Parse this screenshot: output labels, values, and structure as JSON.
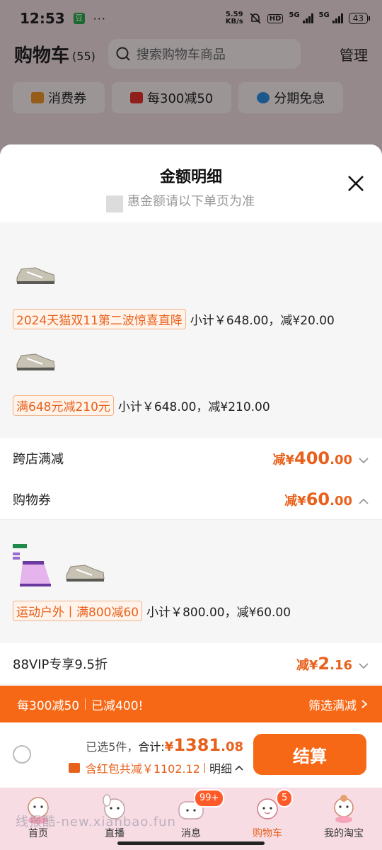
{
  "status_bar": {
    "time": "12:53",
    "app_badge": "豆",
    "more": "···",
    "speed_top": "5.59",
    "speed_bottom": "KB/s",
    "hd": "HD",
    "net1": "5G",
    "net2": "5G",
    "battery": "43"
  },
  "cart": {
    "title": "购物车",
    "count": "(55)",
    "search_placeholder": "搜索购物车商品",
    "manage": "管理",
    "chips": [
      "消费券",
      "每300减50",
      "分期免息"
    ]
  },
  "sheet": {
    "title": "金额明细",
    "subtitle": "惠金额请以下单页为准",
    "groups": [
      {
        "tag": "2024天猫双11第二波惊喜直降",
        "text": "小计￥648.00，减¥20.00"
      },
      {
        "tag": "满648元减210元",
        "text": "小计￥648.00，减¥210.00"
      },
      {
        "tag": "运动户外丨满800减60",
        "text": "小计￥800.00，减¥60.00"
      }
    ],
    "rows": [
      {
        "label": "跨店满减",
        "prefix": "减¥",
        "big": "400",
        "small": ".00"
      },
      {
        "label": "购物券",
        "prefix": "减¥",
        "big": "60",
        "small": ".00"
      },
      {
        "label": "88VIP专享9.5折",
        "prefix": "减¥",
        "big": "2",
        "small": ".16"
      }
    ]
  },
  "banner": {
    "left1": "每300减50",
    "left2": "已减400!",
    "right": "筛选满减"
  },
  "checkout": {
    "selected": "已选5件，",
    "total_label": "合计: ",
    "currency": "¥",
    "total_big": "1381",
    "total_small": ".08",
    "save_text": "含红包共减￥1102.12",
    "detail": "明细",
    "button": "结算"
  },
  "tabbar": {
    "tabs": [
      "首页",
      "直播",
      "消息",
      "购物车",
      "我的淘宝"
    ],
    "badge_msg": "99+",
    "badge_cart": "5"
  },
  "watermark": "线报酷-new.xianbao.fun",
  "colors": {
    "accent": "#f76816",
    "price": "#e8611c",
    "tab_bg": "#f7dce4"
  }
}
